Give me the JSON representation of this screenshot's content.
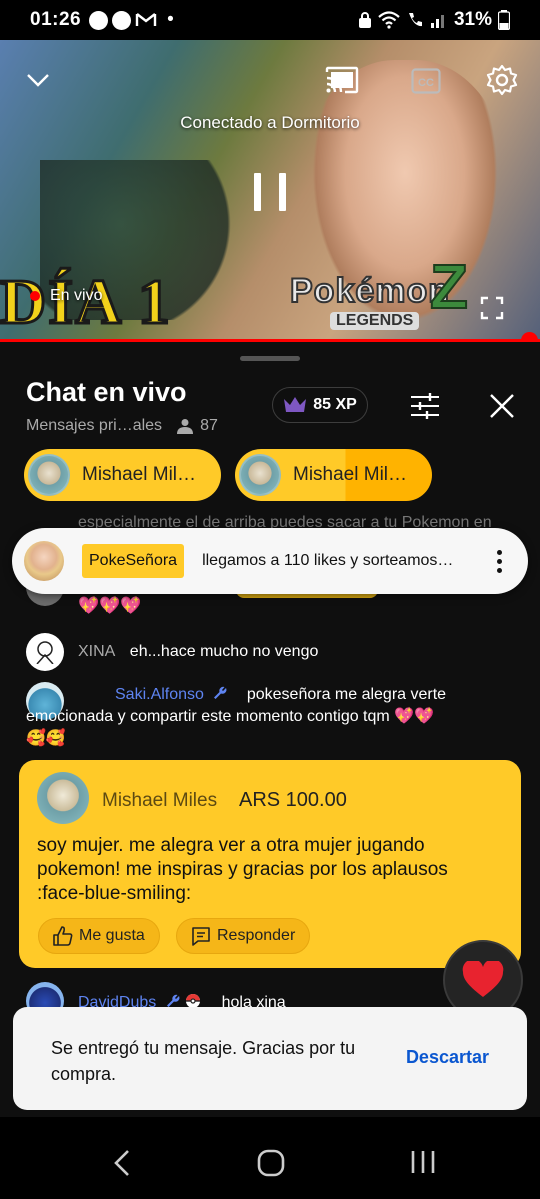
{
  "status_bar": {
    "time": "01:26",
    "battery": "31%",
    "notif_dot": "•"
  },
  "video": {
    "connected_text": "Conectado a Dormitorio",
    "live_label": "En vivo",
    "thumb_day_text": "DÍA 1",
    "thumb_logo_text": "Pokémon",
    "thumb_logo_sub": "LEGENDS",
    "thumb_logo_z": "Z"
  },
  "chat": {
    "title": "Chat en vivo",
    "subtitle": "Mensajes pri…ales",
    "viewer_count": "87",
    "xp": "85 XP",
    "chips": [
      {
        "name": "Mishael Mil…"
      },
      {
        "name": "Mishael Mil…"
      }
    ],
    "partial_line": "especialmente el de arriba puedes sacar a tu Pokemon en",
    "pinned": {
      "author": "PokeSeñora",
      "text": "llegamos a 110 likes y sorteamos…"
    },
    "emoji_line": "💖💖💖",
    "messages": [
      {
        "author": "XINA",
        "text": "eh...hace mucho no vengo"
      },
      {
        "author": "Saki.Alfonso",
        "text_line1": "pokeseñora me alegra verte",
        "text_line2": "emocionada y compartir este momento contigo tqm 💖💖",
        "text_line3": "🥰🥰"
      },
      {
        "author": "DavidDubs",
        "text": "hola xina"
      }
    ],
    "superchat": {
      "author": "Mishael Miles",
      "amount": "ARS 100.00",
      "text": "soy mujer. me alegra ver a otra mujer jugando pokemon! me inspiras y gracias por los aplausos :face-blue-smiling:",
      "like_label": "Me gusta",
      "reply_label": "Responder"
    }
  },
  "toast": {
    "text": "Se entregó tu mensaje. Gracias por tu compra.",
    "dismiss": "Descartar"
  },
  "colors": {
    "accent_red": "#ff0000",
    "superchat_yellow": "#ffca28",
    "link_blue": "#0b57d0",
    "mod_blue": "#5e84f1"
  }
}
